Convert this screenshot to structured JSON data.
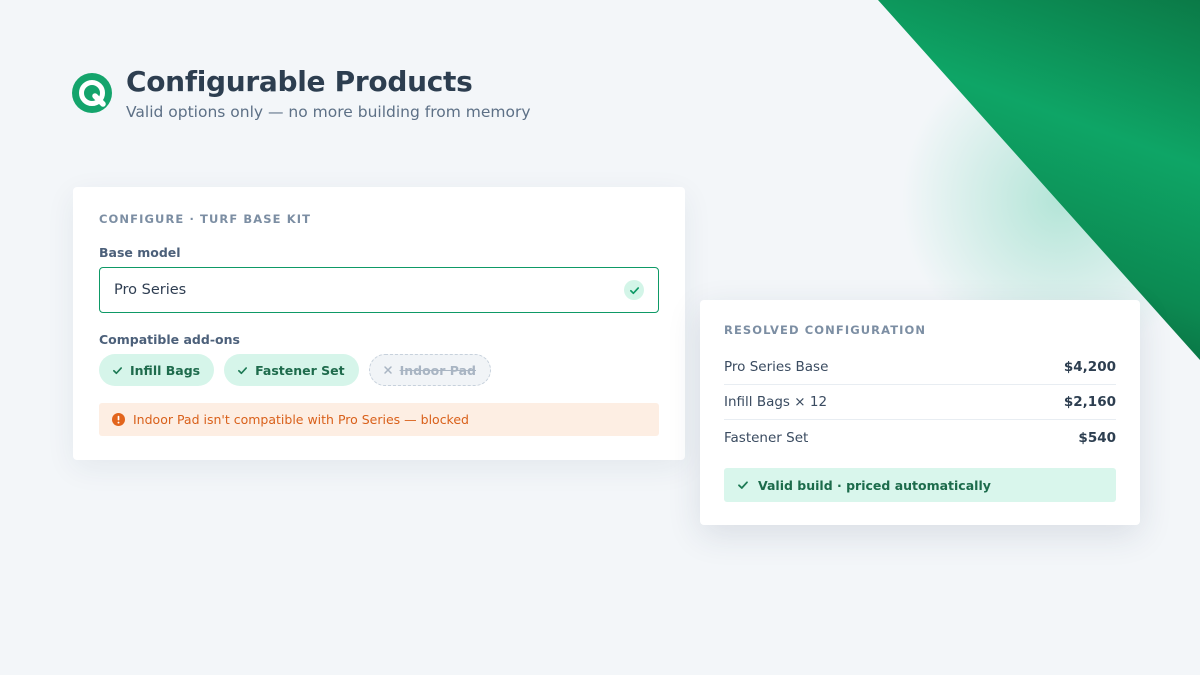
{
  "header": {
    "title": "Configurable Products",
    "subtitle": "Valid options only — no more building from memory",
    "logo_icon": "q-logo-icon",
    "brand_color": "#14a46c"
  },
  "configure_card": {
    "heading": "CONFIGURE · TURF BASE KIT",
    "base_model_label": "Base model",
    "base_model_value": "Pro Series",
    "base_model_status_icon": "check-icon",
    "addons_label": "Compatible add-ons",
    "addons": [
      {
        "label": "Infill Bags",
        "state": "selected",
        "icon": "check-icon"
      },
      {
        "label": "Fastener Set",
        "state": "selected",
        "icon": "check-icon"
      },
      {
        "label": "Indoor Pad",
        "state": "blocked",
        "icon": "x-icon"
      }
    ],
    "alert_text": "Indoor Pad isn't compatible with Pro Series — blocked",
    "alert_icon": "alert-circle-icon"
  },
  "resolved_card": {
    "heading": "RESOLVED CONFIGURATION",
    "lines": [
      {
        "name": "Pro Series Base",
        "price": "$4,200"
      },
      {
        "name": "Infill Bags × 12",
        "price": "$2,160"
      },
      {
        "name": "Fastener Set",
        "price": "$540"
      }
    ],
    "status_text": "Valid build · priced automatically",
    "status_icon": "check-icon"
  }
}
